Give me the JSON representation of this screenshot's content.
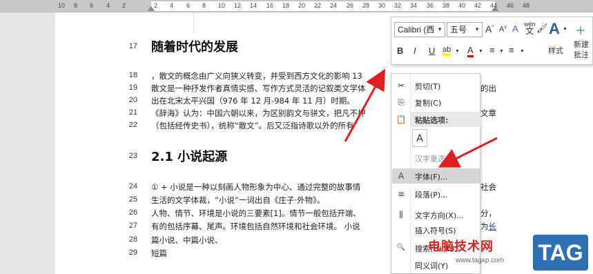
{
  "ruler": {
    "numbers": [
      "10",
      "8",
      "6",
      "4",
      "2",
      "",
      "2",
      "4",
      "6",
      "8",
      "10",
      "12",
      "14",
      "16",
      "18",
      "20",
      "22",
      "24",
      "26",
      "28",
      "30",
      "32",
      "34",
      "36",
      "38",
      "40",
      "42",
      "44",
      "46",
      "48"
    ]
  },
  "document": {
    "lines": [
      {
        "n": "17",
        "kind": "h",
        "text": "随着时代的发展"
      },
      {
        "n": "18",
        "text": "，散文的概念由广义向狭义转变，并受到西方文化的影响 13"
      },
      {
        "n": "19",
        "text": "散文是一种抒发作者真情实感、写作方式灵活的记叙类文学体",
        "tail": "的出"
      },
      {
        "n": "20",
        "text": "出在北宋太平兴国（976 年 12 月-984 年 11 月）时期。"
      },
      {
        "n": "21",
        "text": "《辞海》认为：中国六朝以来，为区别韵文与骈文，把凡不押",
        "tail": "文章"
      },
      {
        "n": "22",
        "text": "（包括经传史书），统称“散文”。后又泛指诗歌以外的所有"
      },
      {
        "n": "23",
        "kind": "h",
        "text": "2.1 小说起源"
      },
      {
        "n": "24",
        "text": "① + 小说是一种以刻画人物形象为中心、通过完整的故事情",
        "tail": "社会"
      },
      {
        "n": "25",
        "text": "生活的文学体裁，“小说”一词出自《庄子·外物》。"
      },
      {
        "n": "26",
        "text": "人物、情节、环境是小说的三要素[1]。情节一般包括开端、",
        "tail": "分，"
      },
      {
        "n": "27",
        "text": "有的包括序幕、尾声。环境包括自然环境和社会环境。 小说",
        "tail": "为长"
      },
      {
        "n": "28",
        "text": "篇小说、中篇小说、"
      },
      {
        "n": "29",
        "text": "短篇"
      }
    ],
    "links": {
      "zhuangzi": "庄子",
      "renwu": "人物",
      "qingjie": "情节",
      "huanjing": "环境",
      "changpian": "长",
      "pian": "篇小说",
      "zhongpian": "中篇小说",
      "duanpian": "短篇"
    }
  },
  "mini_toolbar": {
    "font_name": "Calibri (西",
    "font_size": "五号",
    "grow": "A",
    "shrink": "A",
    "format_clear": "A",
    "phonetic": "wén",
    "painter": "🖌",
    "bold": "B",
    "italic": "I",
    "underline": "U",
    "highlight": "ab",
    "font_color": "A",
    "bullets": "≡",
    "numbering": "≡",
    "styles_label": "样式",
    "new_comment_label_1": "新建",
    "new_comment_label_2": "批注"
  },
  "context_menu": {
    "items": [
      {
        "label": "剪切(T)",
        "icon": "✂"
      },
      {
        "label": "复制(C)",
        "icon": "⎘"
      },
      {
        "label": "粘贴选项:",
        "icon": "📋"
      },
      {
        "label": "汉字重选(V)",
        "icon": ""
      },
      {
        "label": "字体(F)...",
        "icon": "A"
      },
      {
        "label": "段落(P)...",
        "icon": "≡"
      },
      {
        "label": "文字方向(X)...",
        "icon": "⫼"
      },
      {
        "label": "插入符号(S)",
        "icon": ""
      },
      {
        "label": "搜索(H)\"13\"",
        "icon": "🔍"
      },
      {
        "label": "同义词(Y)",
        "icon": ""
      }
    ]
  },
  "watermark": {
    "site": "电脑技术网",
    "url": "www.tagxp.com",
    "tag": "TAG"
  },
  "colors": {
    "arrow": "#e02020",
    "link": "#1a3fb5",
    "highlight": "#ffff00",
    "font_color": "#e00000"
  }
}
